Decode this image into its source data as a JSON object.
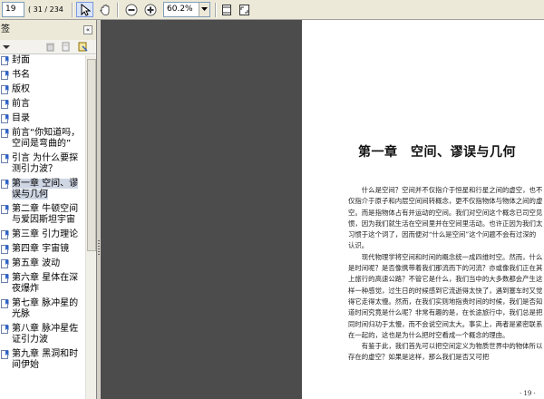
{
  "toolbar": {
    "page_input": "19",
    "page_count": "( 31 / 234 )",
    "zoom_value": "60.2%",
    "tools": [
      "select-tool",
      "hand-tool",
      "zoom-out",
      "zoom-in",
      "fit-width",
      "fit-page"
    ]
  },
  "panel": {
    "title": "签",
    "collapse_label": "«",
    "bookmarks": [
      "封面",
      "书名",
      "版权",
      "前言",
      "目录",
      "前言“你知道吗，空间是弯曲的”",
      "引言 为什么要探测引力波？",
      "第一章 空间、谬误与几何",
      "第二章 牛顿空间与爱因斯坦宇宙",
      "第三章 引力理论",
      "第四章 宇宙镜",
      "第五章 波动",
      "第六章 星体在深夜爆炸",
      "第七章 脉冲星的光脉",
      "第八章 脉冲星佐证引力波",
      "第九章 黑洞和时间伊始"
    ],
    "selected_index": 7
  },
  "page": {
    "chapter_title": "第一章　空间、谬误与几何",
    "paragraphs": [
      "　　什么是空间？空间并不仅指介于恒星和行星之间的虚空，也不仅指介于原子和内层空间间转概念，更不仅指物体与物体之间的虚空。而是指物体占有并运动的空间。我们对空间这个概念已司空见惯，因为我们就生活在空间里并在空间里活动。也许正因为我们太习惯于这个词了，因而便对“什么是空间”这个问题不会有过深的认识。",
      "　　现代物理学将空间和时间的概念统一成四维时空。然而，什么是时间呢？是否像携带着我们那流而下的河流？亦或像我们正在其上旅行的高速公路？不管它是什么，我们当中的大多数都会产生这样一种感觉，过生日的时候感到它流逝得太快了，遇到塞车时又觉得它走得太慢。然而，在我们实则地指责时间的时候，我们是否知道时间究竟是什么呢？非常有趣的是，在长途旅行中，我们总是把同时间归功于太慢，而不会说空间太大。事实上，两者是紧密联系在一起的，这也是为什么把时空看成一个概念的理由。",
      "　　有鉴于此，我们首先可以把空间定义为物质世界中的物体所以存在的虚空？如果是这样，那么我们是否又可把"
    ],
    "page_number": "· 19 ·"
  }
}
